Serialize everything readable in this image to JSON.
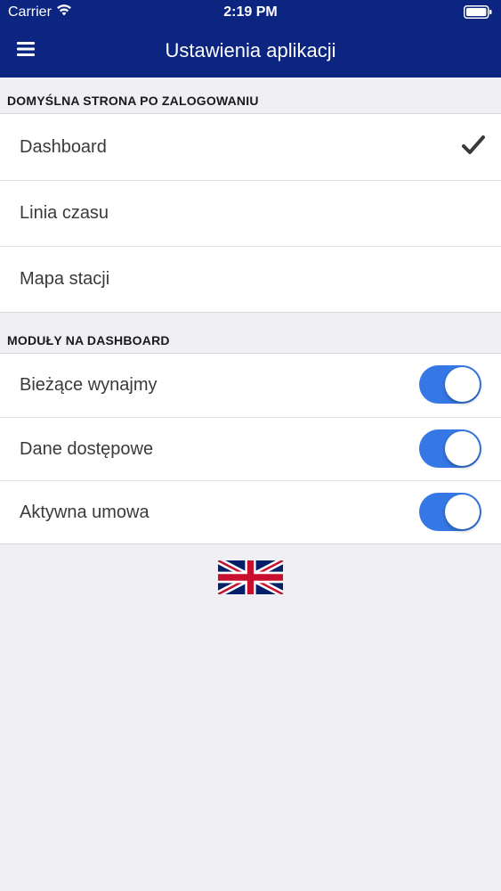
{
  "status_bar": {
    "carrier": "Carrier",
    "time": "2:19 PM"
  },
  "nav": {
    "title": "Ustawienia aplikacji",
    "menu_icon": "hamburger-icon"
  },
  "default_page_section": {
    "header": "DOMYŚLNA STRONA PO ZALOGOWANIU",
    "options": [
      {
        "label": "Dashboard",
        "selected": true
      },
      {
        "label": "Linia czasu",
        "selected": false
      },
      {
        "label": "Mapa stacji",
        "selected": false
      }
    ]
  },
  "modules_section": {
    "header": "MODUŁY NA DASHBOARD",
    "modules": [
      {
        "label": "Bieżące wynajmy",
        "enabled": true
      },
      {
        "label": "Dane dostępowe",
        "enabled": true
      },
      {
        "label": "Aktywna umowa",
        "enabled": true
      }
    ]
  },
  "language": {
    "icon": "uk-flag-icon"
  },
  "colors": {
    "nav_background": "#0b2580",
    "toggle_on": "#3578e5",
    "page_background": "#efeff4"
  }
}
